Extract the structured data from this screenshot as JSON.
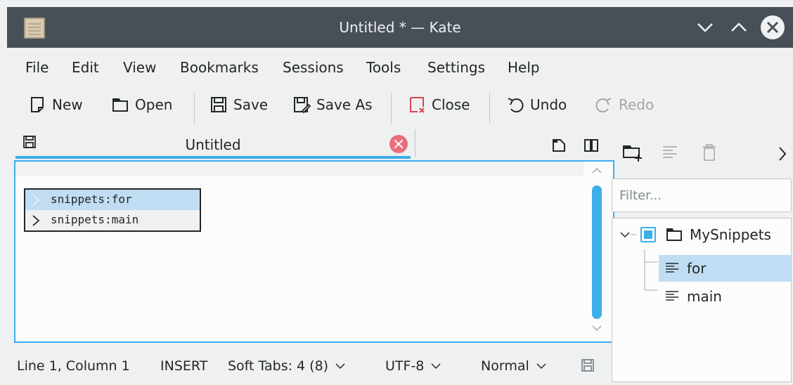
{
  "window": {
    "title": "Untitled * — Kate"
  },
  "menubar": [
    "File",
    "Edit",
    "View",
    "Bookmarks",
    "Sessions",
    "Tools",
    "Settings",
    "Help"
  ],
  "toolbar": {
    "new": "New",
    "open": "Open",
    "save": "Save",
    "save_as": "Save As",
    "close": "Close",
    "undo": "Undo",
    "redo": "Redo"
  },
  "tab": {
    "label": "Untitled"
  },
  "completion": {
    "items": [
      "snippets:for",
      "snippets:main"
    ],
    "selected_index": 0
  },
  "statusbar": {
    "position": "Line 1, Column 1",
    "mode": "INSERT",
    "indent": "Soft Tabs: 4 (8)",
    "encoding": "UTF-8",
    "highlight": "Normal"
  },
  "snippets": {
    "filter_placeholder": "Filter...",
    "repository": "MySnippets",
    "items": [
      "for",
      "main"
    ],
    "selected": "for"
  },
  "colors": {
    "accent": "#3daee9",
    "titlebar": "#475057",
    "selection": "#c0ddf3",
    "close_tab": "#e8707a"
  }
}
